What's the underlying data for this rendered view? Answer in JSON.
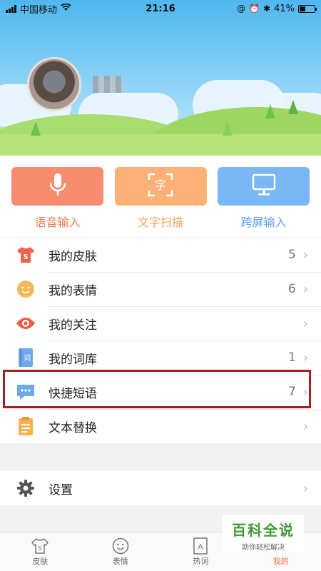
{
  "status_bar": {
    "carrier": "中国移动",
    "time": "21:16",
    "battery": "41%",
    "battery_level": 0.41
  },
  "quick_actions": [
    {
      "label": "语音输入",
      "icon": "microphone-icon",
      "color": "#f98c6e",
      "text_color": "#f1784f"
    },
    {
      "label": "文字扫描",
      "icon": "scan-text-icon",
      "color": "#fdb177",
      "text_color": "#f6a35a"
    },
    {
      "label": "跨屏输入",
      "icon": "monitor-icon",
      "color": "#7ab7f7",
      "text_color": "#5c9ff0"
    }
  ],
  "menu": [
    {
      "label": "我的皮肤",
      "count": "5",
      "icon": "skin-icon"
    },
    {
      "label": "我的表情",
      "count": "6",
      "icon": "emoji-icon"
    },
    {
      "label": "我的关注",
      "count": "",
      "icon": "eye-icon"
    },
    {
      "label": "我的词库",
      "count": "1",
      "icon": "dictionary-icon"
    },
    {
      "label": "快捷短语",
      "count": "7",
      "icon": "chat-bubble-icon"
    },
    {
      "label": "文本替换",
      "count": "",
      "icon": "clipboard-icon"
    }
  ],
  "settings": {
    "label": "设置",
    "icon": "gear-icon"
  },
  "tabs": [
    {
      "label": "皮肤",
      "icon": "shirt-icon"
    },
    {
      "label": "表情",
      "icon": "smile-icon"
    },
    {
      "label": "热词",
      "icon": "book-icon"
    },
    {
      "label": "我的",
      "icon": "user-icon",
      "active": true
    }
  ],
  "chevron": "›",
  "watermark": {
    "title": "百科全说",
    "subtitle": "助你轻松解决"
  },
  "accent_color": "#f26b3a"
}
